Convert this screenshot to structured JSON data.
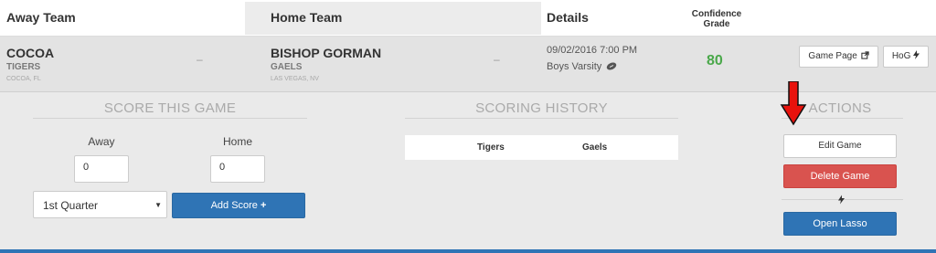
{
  "header": {
    "away_team": "Away Team",
    "home_team": "Home Team",
    "details": "Details",
    "confidence_line1": "Confidence",
    "confidence_line2": "Grade"
  },
  "game": {
    "away": {
      "name": "COCOA",
      "mascot": "TIGERS",
      "location": "COCOA, FL",
      "score": "–"
    },
    "home": {
      "name": "BISHOP GORMAN",
      "mascot": "GAELS",
      "location": "LAS VEGAS, NV",
      "score": "–"
    },
    "date_time": "09/02/2016 7:00 PM",
    "level": "Boys Varsity",
    "confidence_grade": "80",
    "game_page_label": "Game Page",
    "hog_label": "HoG"
  },
  "score_section": {
    "title": "SCORE THIS GAME",
    "away_label": "Away",
    "home_label": "Home",
    "away_value": "0",
    "home_value": "0",
    "period_selected": "1st Quarter",
    "add_score_label": "Add Score"
  },
  "history_section": {
    "title": "SCORING HISTORY",
    "columns": [
      "Tigers",
      "Gaels"
    ]
  },
  "actions_section": {
    "title": "ACTIONS",
    "edit_label": "Edit Game",
    "delete_label": "Delete Game",
    "lasso_label": "Open Lasso"
  },
  "colors": {
    "accent_blue": "#2f74b5",
    "danger_red": "#d9534f",
    "grade_green": "#4aa84a",
    "arrow_red": "#e8120c"
  },
  "icons": [
    "external-link-icon",
    "bolt-icon",
    "football-icon",
    "plus-icon",
    "dropdown-caret-icon",
    "red-down-arrow"
  ]
}
